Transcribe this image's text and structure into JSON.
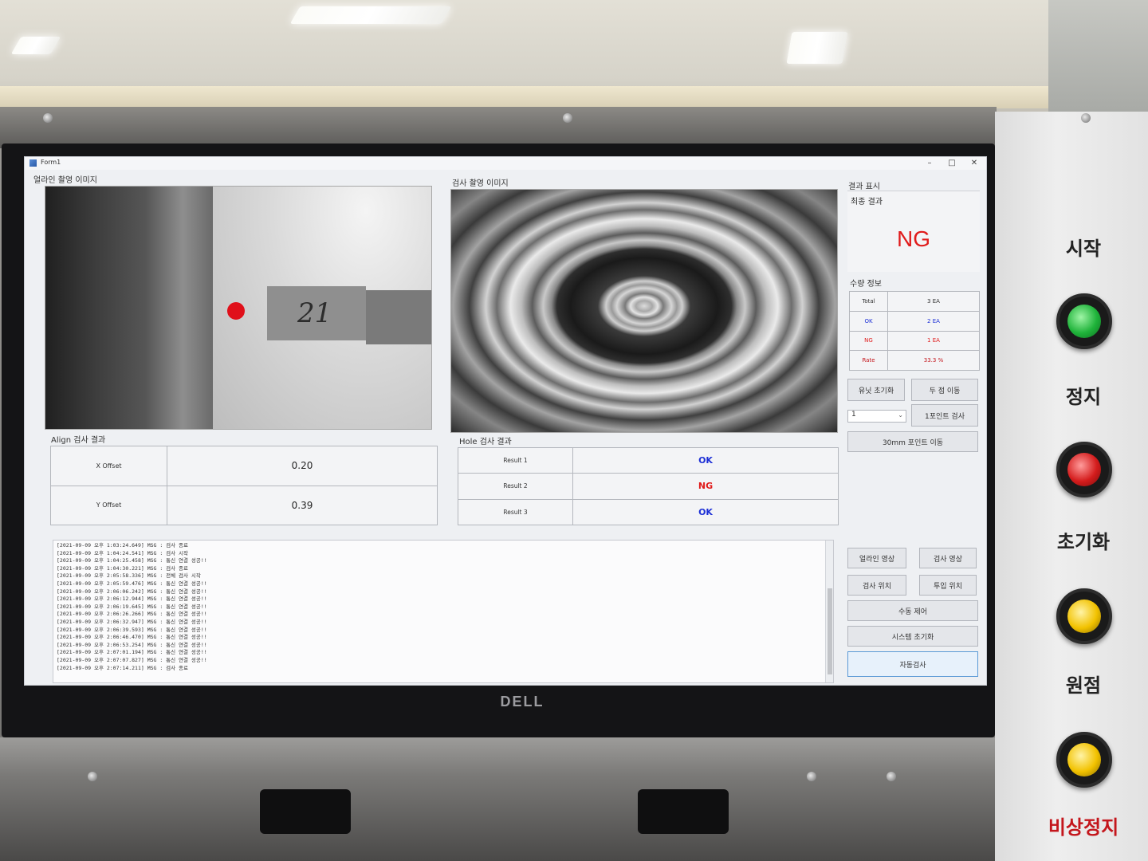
{
  "window": {
    "title": "Form1",
    "minimize": "–",
    "maximize": "□",
    "close": "✕"
  },
  "align_group": {
    "title": "얼라인 촬영 이미지",
    "result_title": "Align 검사 결과",
    "rows": [
      {
        "label": "X Offset",
        "value": "0.20"
      },
      {
        "label": "Y Offset",
        "value": "0.39"
      }
    ],
    "plate_mark": "21"
  },
  "hole_group": {
    "title": "검사 촬영 이미지",
    "result_title": "Hole 검사 결과",
    "rows": [
      {
        "label": "Result 1",
        "value": "OK",
        "color": "#1c2fd6"
      },
      {
        "label": "Result 2",
        "value": "NG",
        "color": "#e01b1b"
      },
      {
        "label": "Result 3",
        "value": "OK",
        "color": "#1c2fd6"
      }
    ]
  },
  "result_panel": {
    "title": "결과 표시",
    "final_label": "최종 결과",
    "final_value": "NG",
    "final_color": "#e01b1b",
    "count_title": "수량 정보",
    "counts": [
      {
        "label": "Total",
        "value": "3 EA",
        "color": "#333333"
      },
      {
        "label": "OK",
        "value": "2 EA",
        "color": "#1c2fd6"
      },
      {
        "label": "NG",
        "value": "1 EA",
        "color": "#e01b1b"
      },
      {
        "label": "Rate",
        "value": "33.3 %",
        "color": "#c4161c"
      }
    ]
  },
  "controls": {
    "unit_reset": "유닛 초기화",
    "two_point_move": "두 점 이동",
    "point_select": "1",
    "one_point_inspect": "1포인트 검사",
    "move_30mm": "30mm 포인트 이동",
    "align_video": "얼라인 영상",
    "inspect_video": "검사 영상",
    "inspect_pos": "검사 위치",
    "input_pos": "투입 위치",
    "manual": "수동 제어",
    "system_reset": "시스템 초기화",
    "auto": "자동검사"
  },
  "log": [
    "[2021-09-09 오후 1:03:24.649] MSG : 검사 종료",
    "[2021-09-09 오후 1:04:24.541] MSG : 검사 시작",
    "[2021-09-09 오후 1:04:25.458] MSG : 통신 연결 성공!!",
    "[2021-09-09 오후 1:04:30.221] MSG : 검사 종료",
    "[2021-09-09 오후 2:05:58.336] MSG : 전체 검사 시작",
    "[2021-09-09 오후 2:05:59.476] MSG : 통신 연결 성공!!",
    "[2021-09-09 오후 2:06:06.242] MSG : 통신 연결 성공!!",
    "[2021-09-09 오후 2:06:12.944] MSG : 통신 연결 성공!!",
    "[2021-09-09 오후 2:06:19.645] MSG : 통신 연결 성공!!",
    "[2021-09-09 오후 2:06:26.266] MSG : 통신 연결 성공!!",
    "[2021-09-09 오후 2:06:32.947] MSG : 통신 연결 성공!!",
    "[2021-09-09 오후 2:06:39.593] MSG : 통신 연결 성공!!",
    "[2021-09-09 오후 2:06:46.470] MSG : 통신 연결 성공!!",
    "[2021-09-09 오후 2:06:53.254] MSG : 통신 연결 성공!!",
    "[2021-09-09 오후 2:07:01.194] MSG : 통신 연결 성공!!",
    "[2021-09-09 오후 2:07:07.827] MSG : 통신 연결 성공!!",
    "[2021-09-09 오후 2:07:14.211] MSG : 검사 종료"
  ],
  "monitor_brand": "DELL",
  "panel": {
    "start": "시작",
    "stop": "정지",
    "reset": "초기화",
    "origin": "원점",
    "emergency": "비상정지",
    "lamp_colors": [
      "#1fb33a",
      "#d41c1c",
      "#f2c200",
      "#f2c200"
    ]
  }
}
